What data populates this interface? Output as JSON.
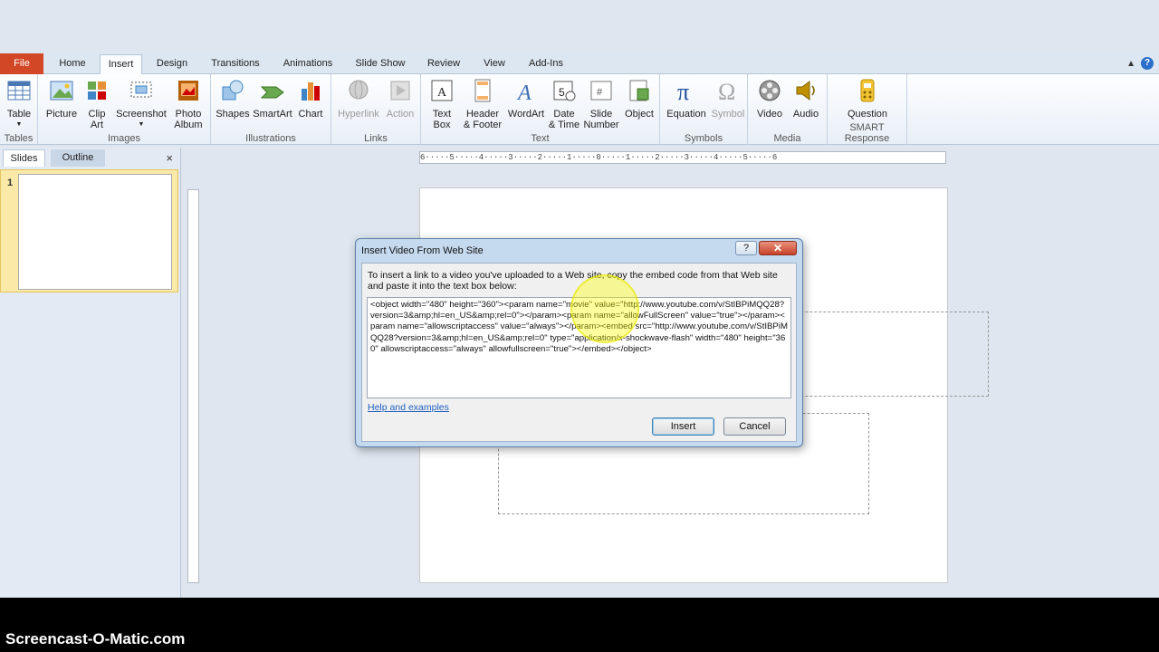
{
  "tabs": {
    "file": "File",
    "items": [
      "Home",
      "Insert",
      "Design",
      "Transitions",
      "Animations",
      "Slide Show",
      "Review",
      "View",
      "Add-Ins"
    ],
    "active": "Insert"
  },
  "ribbon": {
    "groups": {
      "tables": "Tables",
      "images": "Images",
      "illustrations": "Illustrations",
      "links": "Links",
      "text": "Text",
      "symbols": "Symbols",
      "media": "Media",
      "smart": "SMART Response"
    },
    "buttons": {
      "table": "Table",
      "picture": "Picture",
      "clip_art_1": "Clip",
      "clip_art_2": "Art",
      "screenshot": "Screenshot",
      "photo_album_1": "Photo",
      "photo_album_2": "Album",
      "shapes": "Shapes",
      "smartart": "SmartArt",
      "chart": "Chart",
      "hyperlink": "Hyperlink",
      "action": "Action",
      "text_box_1": "Text",
      "text_box_2": "Box",
      "header_footer_1": "Header",
      "header_footer_2": "& Footer",
      "wordart": "WordArt",
      "date_time_1": "Date",
      "date_time_2": "& Time",
      "slide_number_1": "Slide",
      "slide_number_2": "Number",
      "object": "Object",
      "equation": "Equation",
      "symbol": "Symbol",
      "video": "Video",
      "audio": "Audio",
      "question": "Question"
    }
  },
  "panel": {
    "tab_slides": "Slides",
    "tab_outline": "Outline",
    "close": "×",
    "slide_number": "1"
  },
  "ruler": {
    "h_text": "6·····5·····4·····3·····2·····1·····0·····1·····2·····3·····4·····5·····6"
  },
  "dialog": {
    "title": "Insert Video From Web Site",
    "help": "?",
    "close": "✕",
    "instructions": "To insert a link to a video you've uploaded to a Web site, copy the embed code from that Web site and paste it into the text box below:",
    "embed_code": "<object width=\"480\" height=\"360\"><param name=\"movie\" value=\"http://www.youtube.com/v/StIBPiMQQ28?version=3&amp;hl=en_US&amp;rel=0\"></param><param name=\"allowFullScreen\" value=\"true\"></param><param name=\"allowscriptaccess\" value=\"always\"></param><embed src=\"http://www.youtube.com/v/StIBPiMQQ28?version=3&amp;hl=en_US&amp;rel=0\" type=\"application/x-shockwave-flash\" width=\"480\" height=\"360\" allowscriptaccess=\"always\" allowfullscreen=\"true\"></embed></object>",
    "help_link": "Help and examples",
    "insert_button": "Insert",
    "cancel_button": "Cancel"
  },
  "watermark": "Screencast-O-Matic.com",
  "colors": {
    "file_tab": "#d24726",
    "highlight": "#ffff00",
    "link": "#1f5fbf"
  }
}
